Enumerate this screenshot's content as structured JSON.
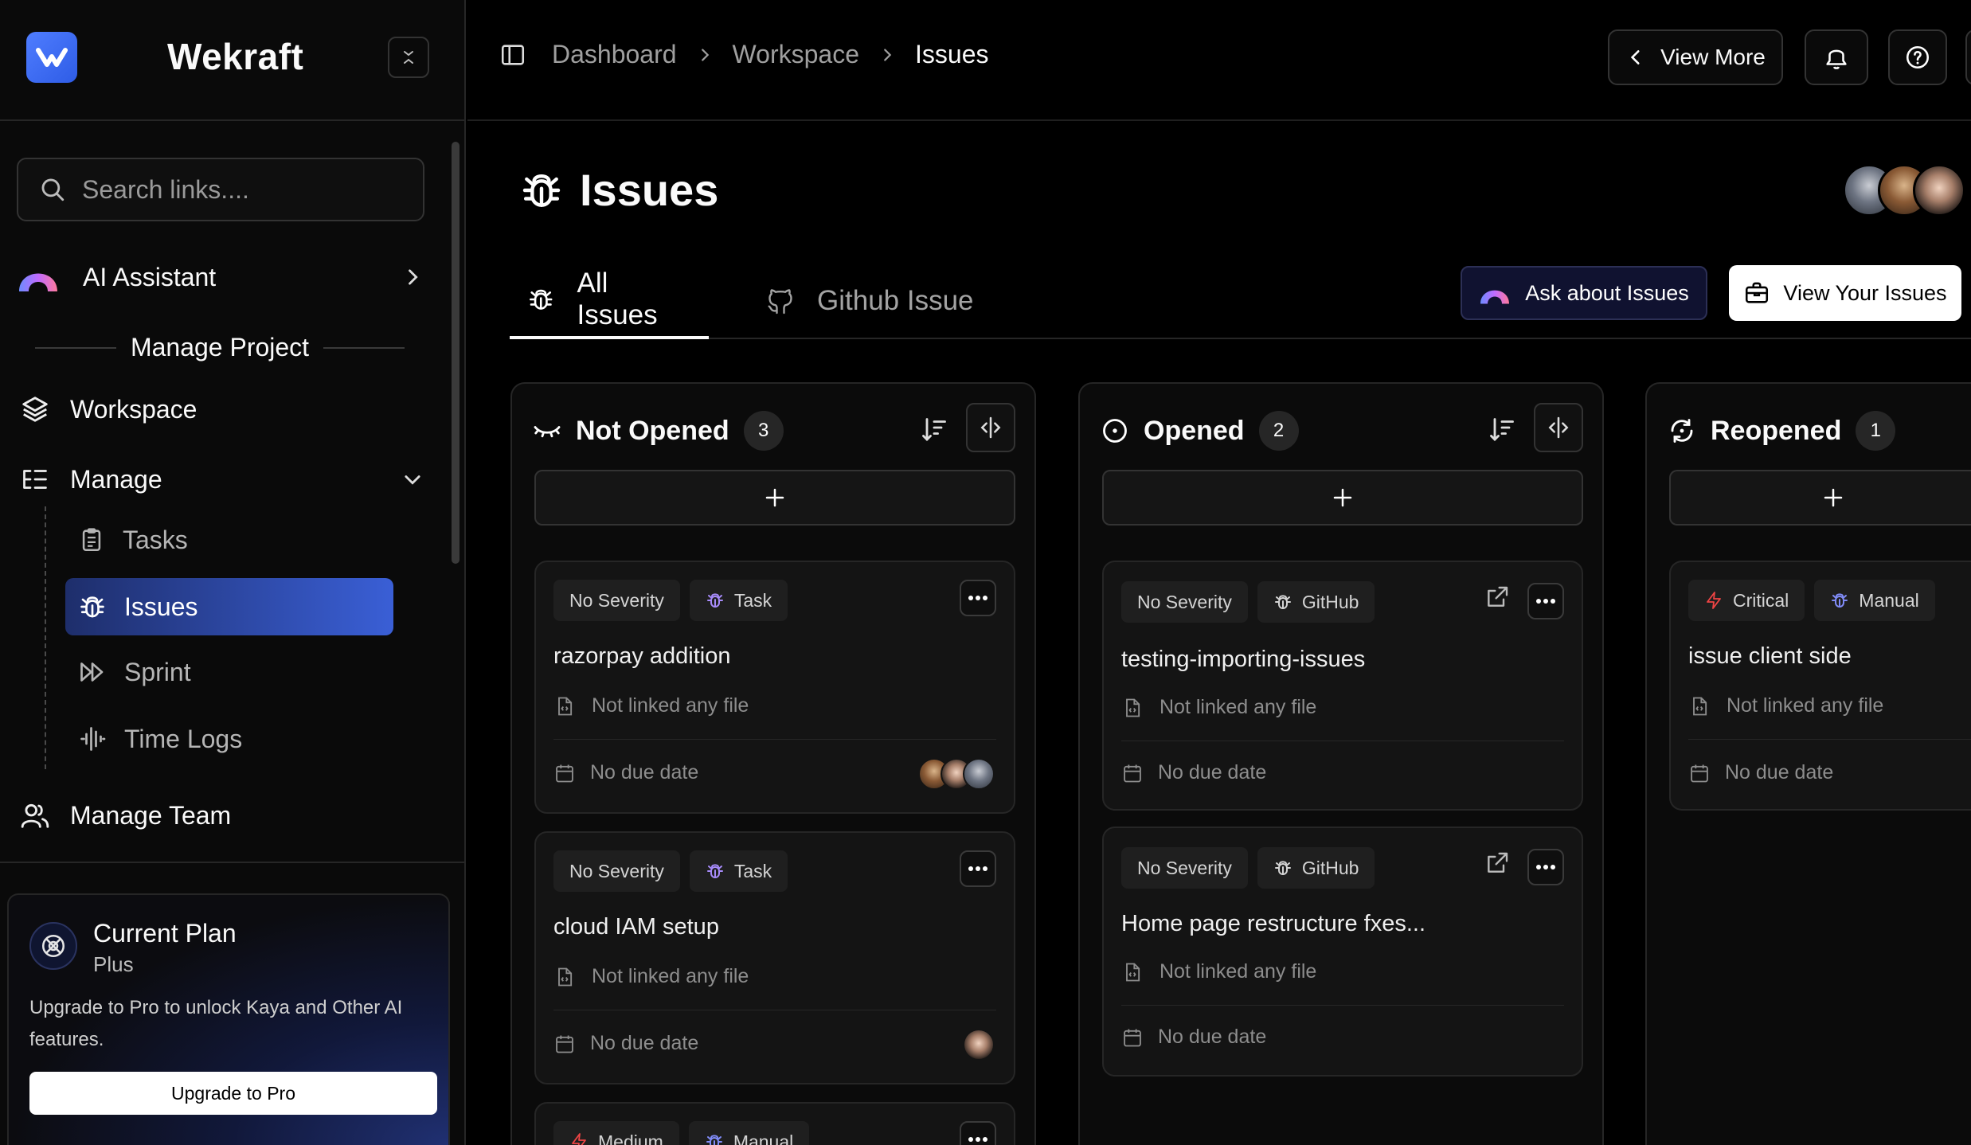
{
  "sidebar": {
    "brand": "Wekraft",
    "search_placeholder": "Search links....",
    "ai_label": "AI Assistant",
    "section_title": "Manage Project",
    "workspace": "Workspace",
    "manage": "Manage",
    "sub_items": [
      "Tasks",
      "Issues",
      "Sprint",
      "Time Logs"
    ],
    "manage_team": "Manage Team",
    "plan": {
      "title": "Current Plan",
      "tier": "Plus",
      "description": "Upgrade to Pro to unlock Kaya and Other AI features.",
      "button": "Upgrade to Pro"
    }
  },
  "topbar": {
    "breadcrumb": [
      "Dashboard",
      "Workspace",
      "Issues"
    ],
    "view_more": "View More"
  },
  "page": {
    "title": "Issues",
    "tabs": [
      "All Issues",
      "Github Issue"
    ],
    "ask_button": "Ask about Issues",
    "view_button": "View Your Issues"
  },
  "columns": [
    {
      "title": "Not Opened",
      "count": "3",
      "cards": [
        {
          "severity": "No Severity",
          "source": "Task",
          "title": "razorpay addition",
          "file": "Not linked any file",
          "due": "No due date"
        },
        {
          "severity": "No Severity",
          "source": "Task",
          "title": "cloud IAM setup",
          "file": "Not linked any file",
          "due": "No due date"
        },
        {
          "severity": "Medium",
          "source": "Manual"
        }
      ]
    },
    {
      "title": "Opened",
      "count": "2",
      "cards": [
        {
          "severity": "No Severity",
          "source": "GitHub",
          "title": "testing-importing-issues",
          "file": "Not linked any file",
          "due": "No due date"
        },
        {
          "severity": "No Severity",
          "source": "GitHub",
          "title": "Home page restructure fxes...",
          "file": "Not linked any file",
          "due": "No due date"
        }
      ]
    },
    {
      "title": "Reopened",
      "count": "1",
      "cards": [
        {
          "severity": "Critical",
          "source": "Manual",
          "title": "issue client side",
          "file": "Not linked any file",
          "due": "No due date"
        }
      ]
    }
  ],
  "colors": {
    "accent": "#3a5fd6",
    "background": "#000000",
    "card": "#141414",
    "task_icon": "#a78bfa",
    "manual_icon": "#818cf8",
    "severity_icon": "#ef4444"
  }
}
